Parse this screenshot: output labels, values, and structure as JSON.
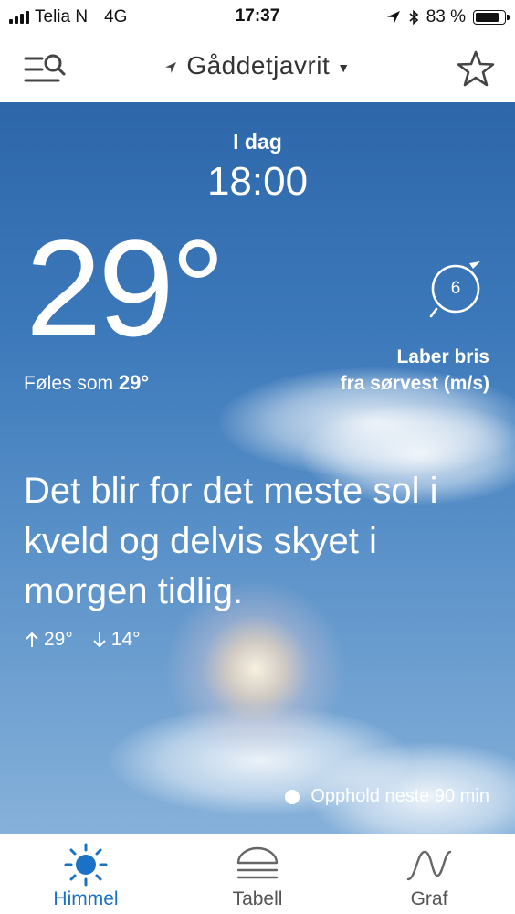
{
  "status_bar": {
    "carrier": "Telia N",
    "network": "4G",
    "time": "17:37",
    "battery_text": "83 %",
    "battery_level": 0.83
  },
  "header": {
    "location": "Gåddetjavrit",
    "icons": {
      "menu": "menu-search-icon",
      "location": "location-arrow-icon",
      "favorite": "star-icon"
    }
  },
  "forecast": {
    "day": "I dag",
    "time": "18:00",
    "temperature": "29°",
    "feels_like_label": "Føles som",
    "feels_like_value": "29°",
    "wind_speed": "6",
    "wind_desc_line1": "Laber bris",
    "wind_desc_line2": "fra sørvest (m/s)",
    "summary": "Det blir for det meste sol i kveld og delvis skyet i morgen tidlig.",
    "max_temp": "29°",
    "min_temp": "14°",
    "precipitation_note": "Opphold neste 90 min"
  },
  "tabs": [
    {
      "label": "Himmel",
      "icon": "sun-icon",
      "active": true
    },
    {
      "label": "Tabell",
      "icon": "table-icon",
      "active": false
    },
    {
      "label": "Graf",
      "icon": "graph-icon",
      "active": false
    }
  ],
  "colors": {
    "accent": "#1a72c6",
    "sky_top": "#2d67a9",
    "sky_bottom": "#86b1da",
    "tab_inactive": "#555555"
  }
}
